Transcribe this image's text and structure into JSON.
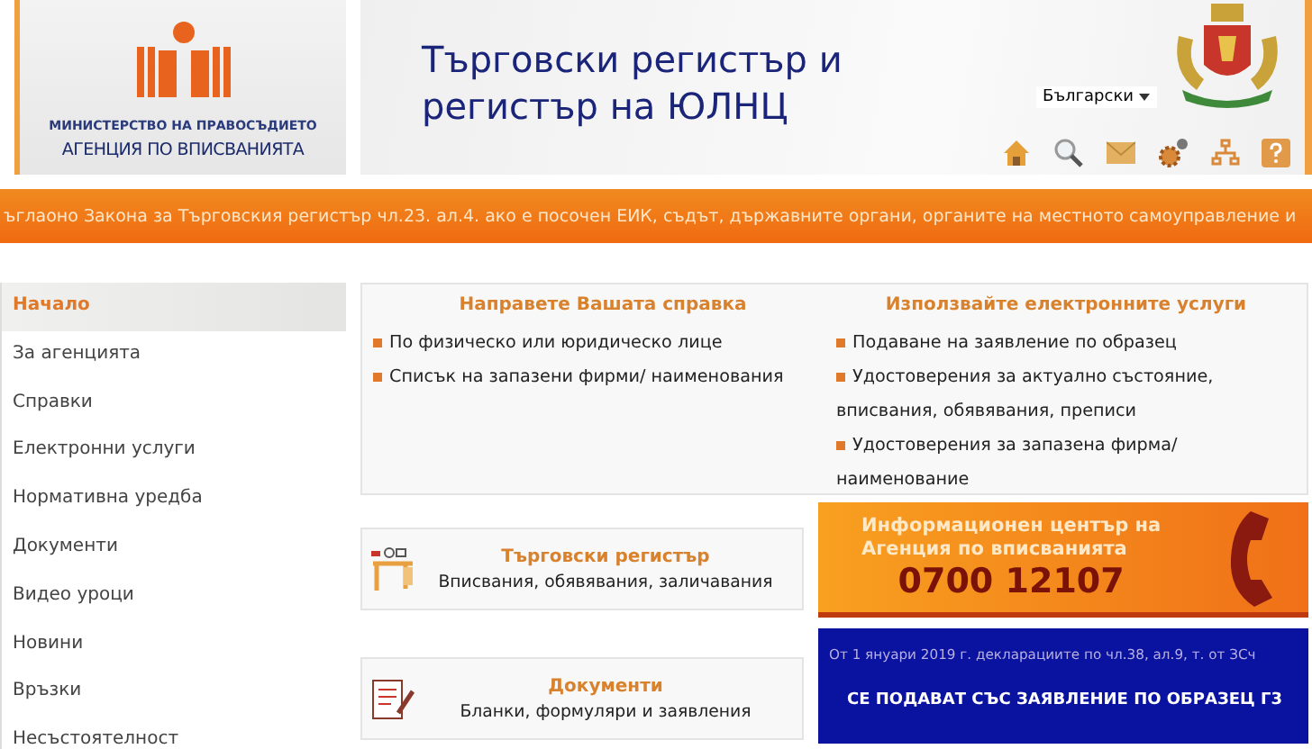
{
  "agency": {
    "ministry": "МИНИСТЕРСТВО НА ПРАВОСЪДИЕТО",
    "name": "АГЕНЦИЯ ПО ВПИСВАНИЯТА"
  },
  "banner": {
    "title_lines": [
      "Търговски регистър и",
      "регистър на ЮЛНЦ"
    ],
    "language": "Български"
  },
  "ticker": "ъглаоно Закона за Търговския регистър чл.23. ал.4. ако е посочен ЕИК, съдът, държавните органи, органите на местното самоуправление и",
  "sidebar": {
    "items": [
      {
        "label": "Начало",
        "selected": true
      },
      {
        "label": "За агенцията",
        "selected": false
      },
      {
        "label": "Справки",
        "selected": false
      },
      {
        "label": "Електронни услуги",
        "selected": false
      },
      {
        "label": "Нормативна уредба",
        "selected": false
      },
      {
        "label": "Документи",
        "selected": false
      },
      {
        "label": "Видео уроци",
        "selected": false
      },
      {
        "label": "Новини",
        "selected": false
      },
      {
        "label": "Връзки",
        "selected": false
      },
      {
        "label": "Несъстоятелност",
        "selected": false
      }
    ]
  },
  "services": [
    {
      "title": "Направете Вашата справка",
      "links": [
        "По физическо или юридическо лице",
        "Списък на запазени фирми/ наименования"
      ]
    },
    {
      "title": "Използвайте електронните услуги",
      "links": [
        "Подаване на заявление по образец",
        "Удостоверения за актуално състояние, вписвания, обявявания, преписи",
        "Удостоверения за запазена фирма/наименование"
      ]
    }
  ],
  "registers": [
    {
      "kind": "register",
      "title": "Търговски регистър",
      "text": "Вписвания, обявявания, заличавания"
    },
    {
      "kind": "documents",
      "title": "Документи",
      "text": "Бланки, формуляри и заявления"
    }
  ],
  "info_center": {
    "lines": [
      "Информационен център на",
      "Агенция по вписванията"
    ],
    "phone": "0700 12107"
  },
  "notice": {
    "text": "От 1 януари 2019 г. декларациите по чл.38, ал.9, т. от ЗСч",
    "headline": "СЕ ПОДАВАТ СЪС ЗАЯВЛЕНИЕ ПО ОБРАЗЕЦ Г3"
  }
}
